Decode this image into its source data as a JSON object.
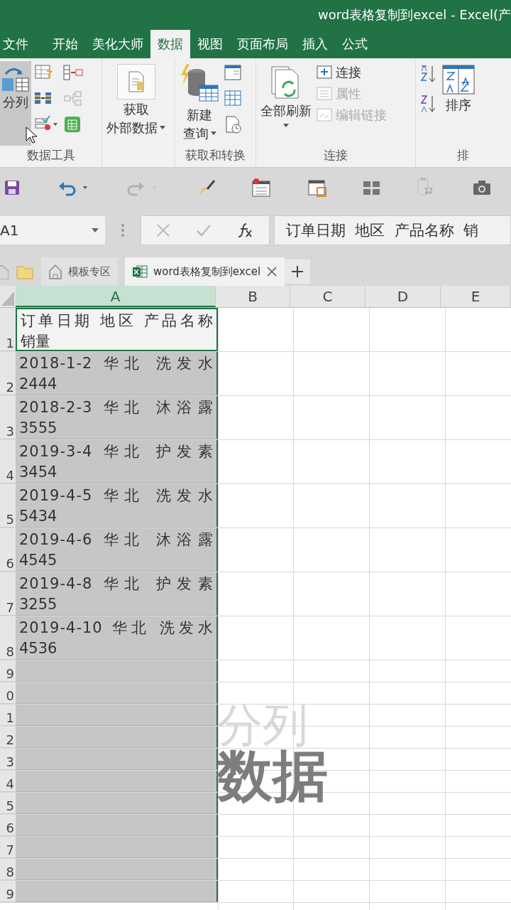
{
  "window": {
    "title": "word表格复制到excel - Excel(产"
  },
  "ribbon_tabs": [
    {
      "label": "文件",
      "selected": false
    },
    {
      "label": "开始",
      "selected": false
    },
    {
      "label": "美化大师",
      "selected": false
    },
    {
      "label": "数据",
      "selected": true
    },
    {
      "label": "视图",
      "selected": false
    },
    {
      "label": "页面布局",
      "selected": false
    },
    {
      "label": "插入",
      "selected": false
    },
    {
      "label": "公式",
      "selected": false
    }
  ],
  "ribbon": {
    "groups": [
      {
        "label": "数据工具",
        "buttons": [
          {
            "label": "分列",
            "highlighted": true
          }
        ]
      },
      {
        "buttons": [
          {
            "lines": [
              "获取",
              "外部数据"
            ],
            "dropdown": true
          }
        ]
      },
      {
        "label": "获取和转换",
        "buttons": [
          {
            "lines": [
              "新建",
              "查询"
            ],
            "dropdown": true
          }
        ]
      },
      {
        "label": "连接",
        "buttons": [
          {
            "label": "全部刷新",
            "dropdown": true
          },
          {
            "label": "连接",
            "disabled": false
          },
          {
            "label": "属性",
            "disabled": true
          },
          {
            "label": "编辑链接",
            "disabled": true
          }
        ]
      },
      {
        "label": "排",
        "buttons": [
          {
            "label": "排序"
          }
        ]
      }
    ]
  },
  "quick_access": {
    "badge": "12"
  },
  "formula_bar": {
    "name_box": "A1",
    "formula": "订单日期  地区  产品名称  销"
  },
  "doc_tabs": [
    {
      "label": "模板专区",
      "selected": false
    },
    {
      "label": "word表格复制到excel",
      "selected": true
    }
  ],
  "sheet": {
    "columns": [
      {
        "label": "A",
        "selected": true
      },
      {
        "label": "B",
        "selected": false
      },
      {
        "label": "C",
        "selected": false
      },
      {
        "label": "D",
        "selected": false
      },
      {
        "label": "E",
        "selected": false
      }
    ],
    "rows": [
      {
        "number": "1",
        "active": true,
        "lines": [
          "订单日期 地区 产品名称",
          "销量"
        ]
      },
      {
        "number": "2",
        "active": false,
        "lines": [
          "2018-1-2 华北 洗发水",
          "2444"
        ]
      },
      {
        "number": "3",
        "active": false,
        "lines": [
          "2018-2-3 华北 沐浴露",
          "3555"
        ]
      },
      {
        "number": "4",
        "active": false,
        "lines": [
          "2019-3-4 华北 护发素",
          "3454"
        ]
      },
      {
        "number": "5",
        "active": false,
        "lines": [
          "2019-4-5 华北 洗发水",
          "5434"
        ]
      },
      {
        "number": "6",
        "active": false,
        "lines": [
          "2019-4-6 华北 沐浴露",
          "4545"
        ]
      },
      {
        "number": "7",
        "active": false,
        "lines": [
          "2019-4-8 华北 护发素",
          "3255"
        ]
      },
      {
        "number": "8",
        "active": false,
        "lines": [
          "2019-4-10 华北 洗发水",
          "4536"
        ]
      },
      {
        "number": "9",
        "active": false
      },
      {
        "number": "0",
        "active": false
      },
      {
        "number": "1",
        "active": false
      },
      {
        "number": "2",
        "active": false
      },
      {
        "number": "3",
        "active": false
      },
      {
        "number": "4",
        "active": false
      },
      {
        "number": "5",
        "active": false
      },
      {
        "number": "6",
        "active": false
      },
      {
        "number": "7",
        "active": false
      },
      {
        "number": "8",
        "active": false
      },
      {
        "number": "9",
        "active": false
      }
    ]
  },
  "overlay_caption": {
    "line_1": "分列",
    "line_2": "数据"
  }
}
